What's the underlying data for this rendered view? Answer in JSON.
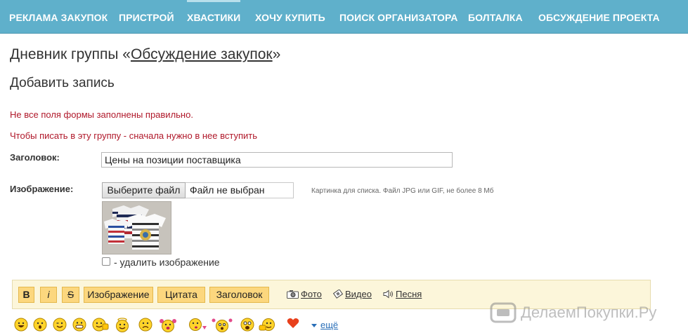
{
  "nav": {
    "items": [
      {
        "label": "РЕКЛАМА ЗАКУПОК"
      },
      {
        "label": "ПРИСТРОЙ"
      },
      {
        "label": "ХВАСТИКИ"
      },
      {
        "label": "ХОЧУ КУПИТЬ"
      },
      {
        "label": "ПОИСК ОРГАНИЗАТОРА"
      },
      {
        "label": "БОЛТАЛКА"
      },
      {
        "label": "ОБСУЖДЕНИЕ ПРОЕКТА"
      }
    ]
  },
  "page": {
    "title_prefix": "Дневник группы «",
    "title_link": "Обсуждение закупок",
    "title_suffix": "»",
    "subtitle": "Добавить запись"
  },
  "errors": {
    "form_invalid": "Не все поля формы заполнены правильно.",
    "must_join": "Чтобы писать в эту группу - сначала нужно в нее вступить"
  },
  "form": {
    "title_label": "Заголовок:",
    "title_value": "Цены на позиции поставщика",
    "image_label": "Изображение:",
    "file_button": "Выберите файл",
    "file_status": "Файл не выбран",
    "image_hint": "Картинка для списка. Файл JPG или GIF, не более 8 Мб",
    "delete_image_label": "- удалить изображение"
  },
  "toolbar": {
    "bold": "B",
    "italic": "i",
    "strike": "S",
    "image": "Изображение",
    "quote": "Цитата",
    "heading": "Заголовок",
    "photo": "Фото",
    "video": "Видео",
    "song": "Песня"
  },
  "smileys": {
    "more_label": "ещё"
  },
  "watermark": {
    "text": "ДелаемПокупки.Ру"
  },
  "colors": {
    "nav_bg": "#5fb0cb",
    "error": "#b0182a",
    "toolbar_bg": "#fcf6da",
    "toolbar_button": "#fcd77e",
    "link": "#2a6fb8"
  }
}
